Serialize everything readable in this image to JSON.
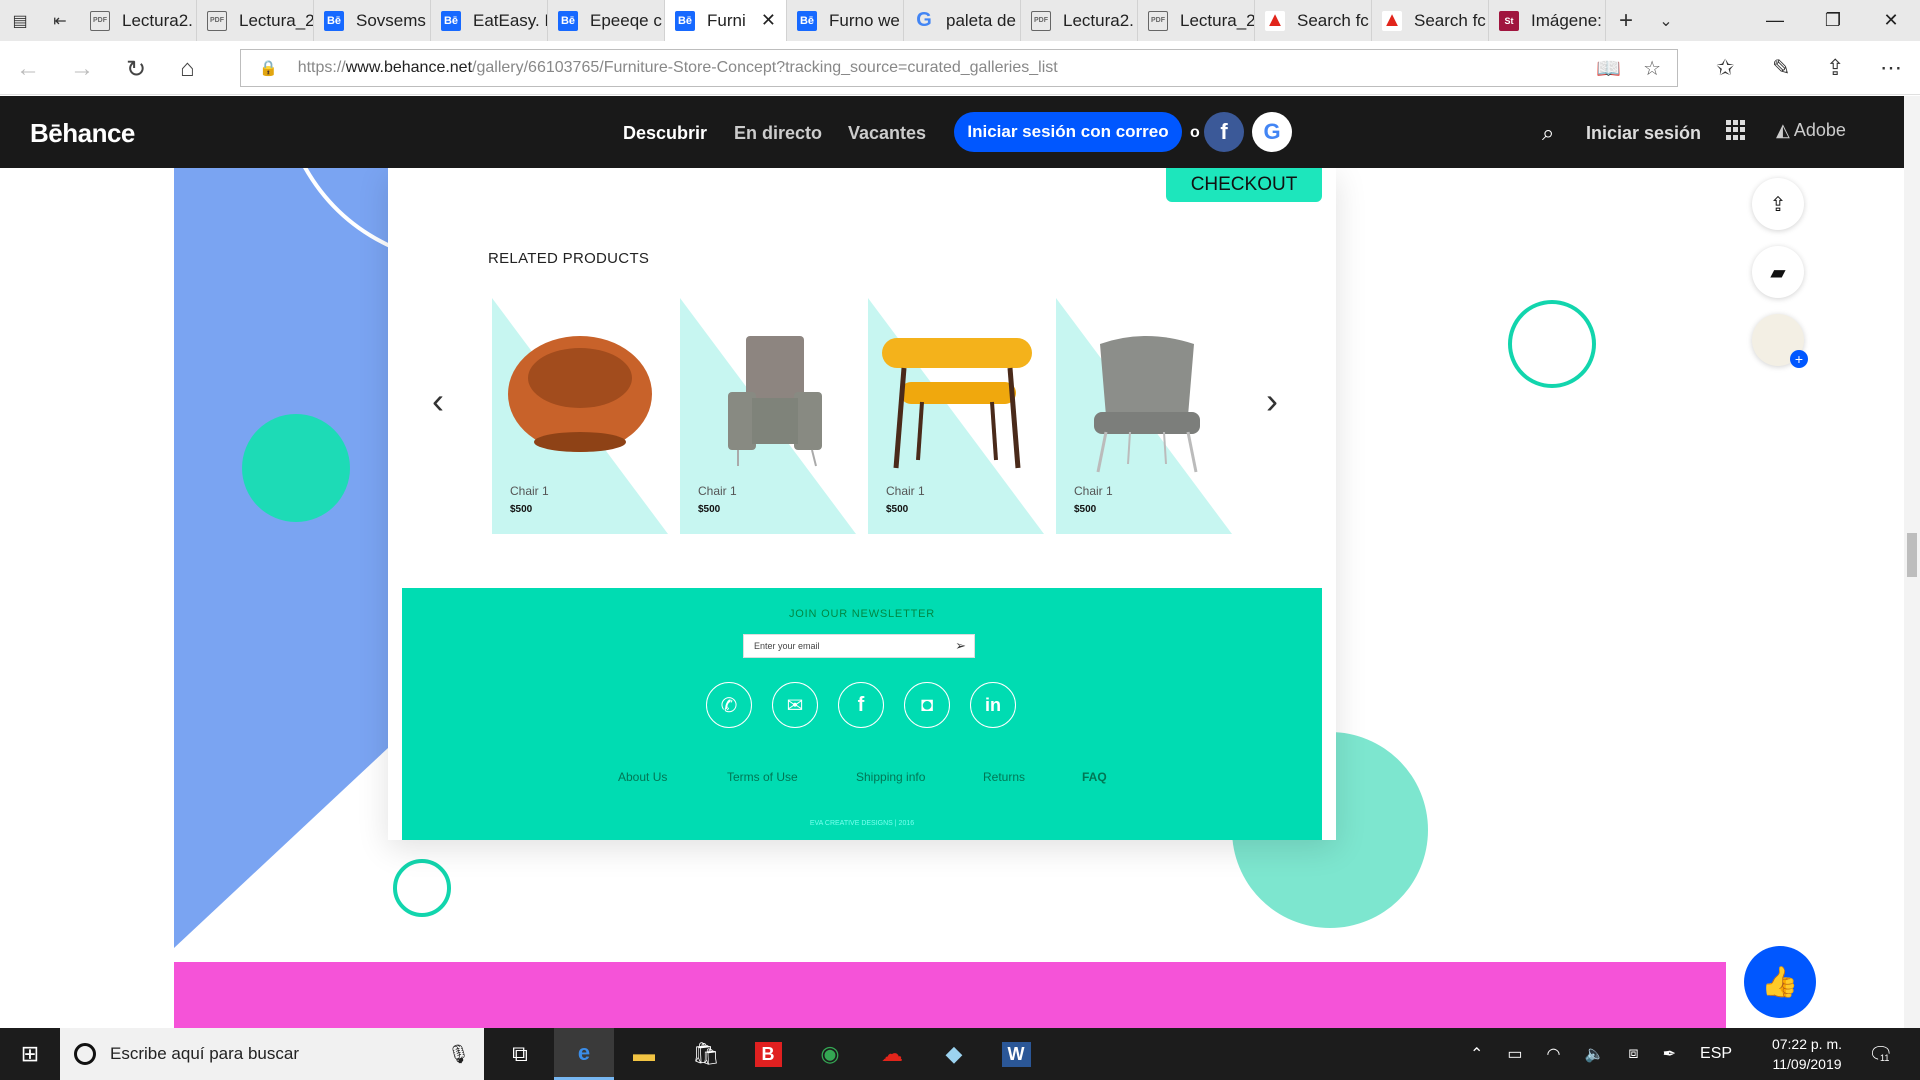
{
  "tabs": [
    {
      "label": "Lectura2.",
      "icon": "pdf-icon"
    },
    {
      "label": "Lectura_2",
      "icon": "pdf-icon"
    },
    {
      "label": "Sovsems",
      "icon": "behance-icon"
    },
    {
      "label": "EatEasy. F",
      "icon": "behance-icon"
    },
    {
      "label": "Epeeqe c",
      "icon": "behance-icon"
    },
    {
      "label": "Furni",
      "icon": "behance-icon",
      "active": true
    },
    {
      "label": "Furno we",
      "icon": "behance-icon"
    },
    {
      "label": "paleta de",
      "icon": "google-icon"
    },
    {
      "label": "Lectura2.",
      "icon": "pdf-icon"
    },
    {
      "label": "Lectura_2",
      "icon": "pdf-icon"
    },
    {
      "label": "Search fc",
      "icon": "adobe-icon"
    },
    {
      "label": "Search fc",
      "icon": "adobe-icon"
    },
    {
      "label": "Imágene:",
      "icon": "stock-icon"
    }
  ],
  "address": {
    "prefix": "https://",
    "domain": "www.behance.net",
    "path": "/gallery/66103765/Furniture-Store-Concept?tracking_source=curated_galleries_list"
  },
  "behance": {
    "logo": "Bēhance",
    "nav": [
      "Descubrir",
      "En directo",
      "Vacantes"
    ],
    "signin_email": "Iniciar sesión con correo",
    "or": "o",
    "login": "Iniciar sesión",
    "adobe": "Adobe"
  },
  "product_page": {
    "checkout": "CHECKOUT",
    "related_title": "RELATED PRODUCTS",
    "products": [
      {
        "name": "Chair 1",
        "price": "$500"
      },
      {
        "name": "Chair 1",
        "price": "$500"
      },
      {
        "name": "Chair 1",
        "price": "$500"
      },
      {
        "name": "Chair 1",
        "price": "$500"
      }
    ],
    "newsletter": {
      "title": "JOIN OUR NEWSLETTER",
      "placeholder": "Enter your email"
    },
    "social": [
      "phone-icon",
      "mail-icon",
      "facebook-icon",
      "instagram-icon",
      "linkedin-icon"
    ],
    "footer_links": [
      "About Us",
      "Terms of Use",
      "Shipping info",
      "Returns",
      "FAQ"
    ],
    "copyright": "EVA CREATIVE DESIGNS | 2016"
  },
  "taskbar": {
    "search_placeholder": "Escribe aquí para buscar",
    "lang": "ESP",
    "time": "07:22 p. m.",
    "date": "11/09/2019",
    "notifications": "11"
  },
  "colors": {
    "accent": "#00dcb2",
    "behance_blue": "#0057ff",
    "periwinkle": "#7aa4f2",
    "magenta": "#f553d8"
  }
}
